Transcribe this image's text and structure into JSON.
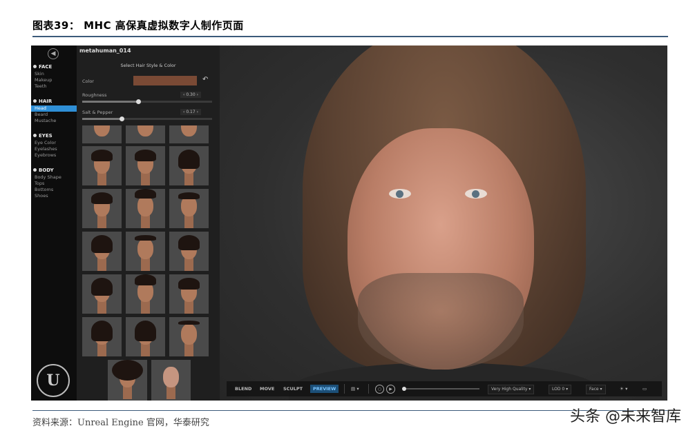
{
  "figure": {
    "title": "图表39： MHC 高保真虚拟数字人制作页面",
    "source": "资料来源：Unreal Engine 官网，华泰研究",
    "watermark": "头条 @未来智库"
  },
  "app": {
    "character_name": "metahuman_014",
    "panel_title": "Select Hair Style & Color",
    "color_label": "Color",
    "roughness_label": "Roughness",
    "roughness_value": "0.30",
    "salt_pepper_label": "Salt & Pepper",
    "salt_pepper_value": "0.17",
    "nav": {
      "face": {
        "label": "FACE",
        "items": [
          "Skin",
          "Makeup",
          "Teeth"
        ]
      },
      "hair": {
        "label": "HAIR",
        "items": [
          "Head",
          "Beard",
          "Mustache"
        ]
      },
      "eyes": {
        "label": "EYES",
        "items": [
          "Eye Color",
          "Eyelashes",
          "Eyebrows"
        ]
      },
      "body": {
        "label": "BODY",
        "items": [
          "Body Shape",
          "Tops",
          "Bottoms",
          "Shoes"
        ]
      }
    },
    "logo_text": "U",
    "toolbar": {
      "blend": "BLEND",
      "move": "MOVE",
      "sculpt": "SCULPT",
      "preview": "PREVIEW",
      "quality": "Very High Quality",
      "lod": "LOD 0",
      "camera": "Face"
    },
    "colors": {
      "accent": "#2f8fd6",
      "hair_color": "#7a4a35",
      "preview_active": "#1c4f78"
    }
  }
}
